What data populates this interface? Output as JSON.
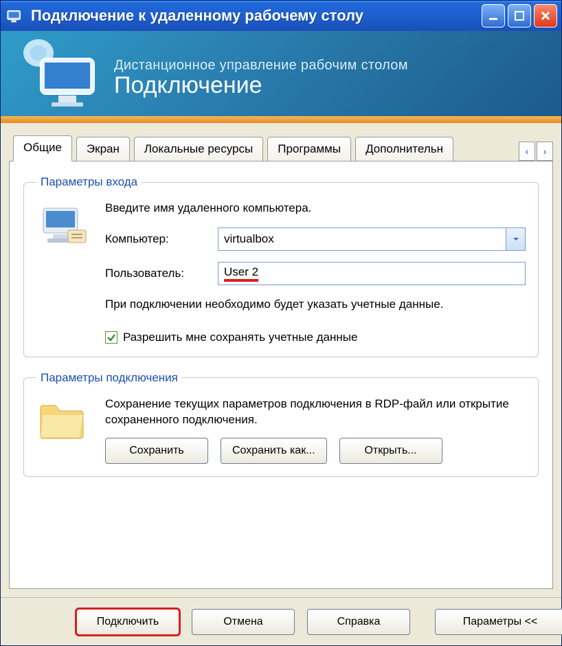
{
  "titlebar": {
    "title": "Подключение к удаленному рабочему столу"
  },
  "banner": {
    "subtitle": "Дистанционное управление рабочим столом",
    "title": "Подключение"
  },
  "tabs": [
    {
      "label": "Общие"
    },
    {
      "label": "Экран"
    },
    {
      "label": "Локальные ресурсы"
    },
    {
      "label": "Программы"
    },
    {
      "label": "Дополнительн"
    }
  ],
  "login": {
    "legend": "Параметры входа",
    "instruction": "Введите имя удаленного компьютера.",
    "computer_label": "Компьютер:",
    "computer_value": "virtualbox",
    "user_label": "Пользователь:",
    "user_value": "User 2",
    "note": "При подключении необходимо будет указать учетные данные.",
    "checkbox_label": "Разрешить мне сохранять учетные данные"
  },
  "connection": {
    "legend": "Параметры подключения",
    "note": "Сохранение текущих параметров подключения в RDP-файл или открытие сохраненного подключения.",
    "save": "Сохранить",
    "saveas": "Сохранить как...",
    "open": "Открыть..."
  },
  "footer": {
    "connect": "Подключить",
    "cancel": "Отмена",
    "help": "Справка",
    "options": "Параметры <<"
  }
}
